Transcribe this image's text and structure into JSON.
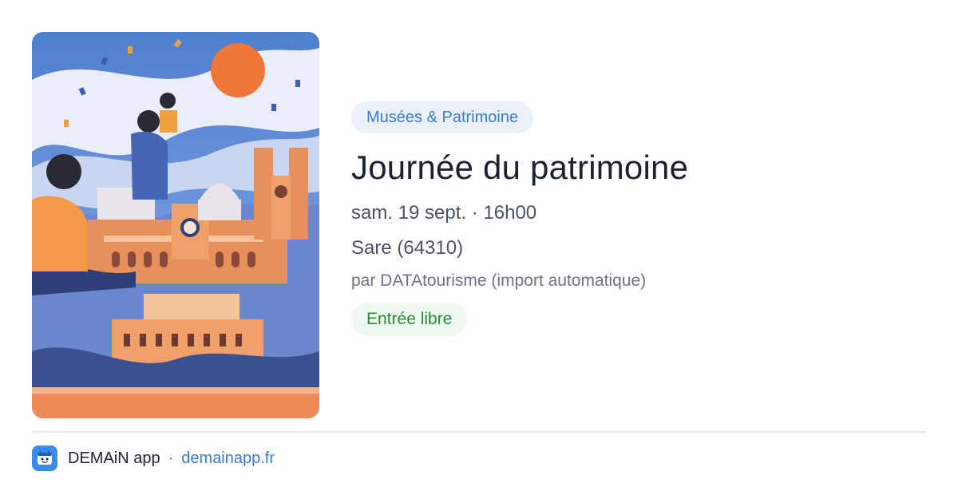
{
  "event": {
    "category": "Musées & Patrimoine",
    "title": "Journée du patrimoine",
    "datetime": "sam. 19 sept. · 16h00",
    "place": "Sare (64310)",
    "organizer": "par DATAtourisme (import automatique)",
    "price": "Entrée libre",
    "image_icon": "heritage-illustration"
  },
  "footer": {
    "app_name": "DEMAiN app",
    "separator": "·",
    "domain": "demainapp.fr",
    "logo_icon": "demain-app-icon"
  },
  "colors": {
    "category_bg": "#eaf1fb",
    "category_text": "#3a7bd5",
    "price_bg": "#eef9f0",
    "price_text": "#2b8a3e",
    "title_text": "#1a2233",
    "link": "#3a7bd5"
  }
}
